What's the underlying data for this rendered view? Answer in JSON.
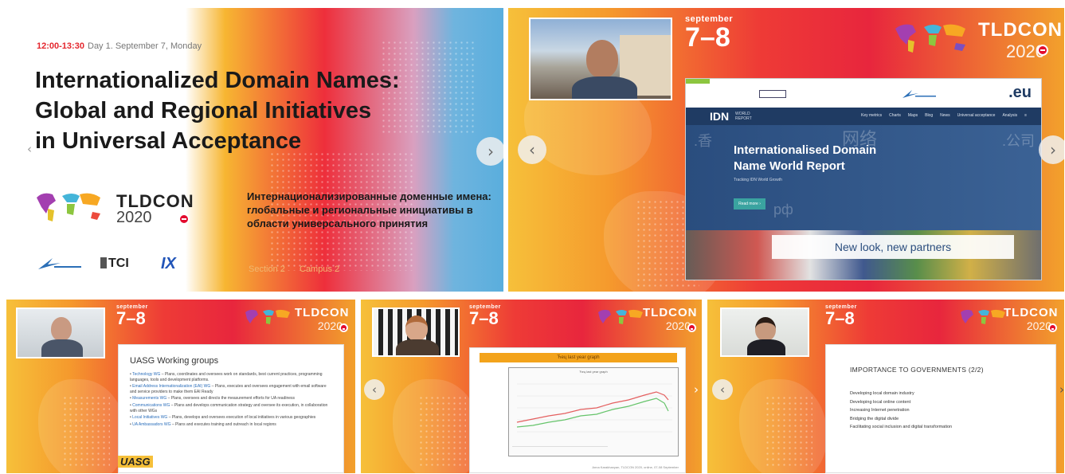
{
  "tile1": {
    "time": "12:00-13:30",
    "day": "Day 1. September 7, Monday",
    "title_lines": [
      "Internationalized Domain Names:",
      "Global and Regional Initiatives",
      "in Universal Acceptance"
    ],
    "brand_name": "TLDCON",
    "brand_year": "2020",
    "ru_title": "Интернационализированные доменные имена: глобальные и региональные инициативы в области универсального принятия",
    "section": "Section 2",
    "campus": "Campus 2",
    "logo_tci": "TCI",
    "logo_ix": "IX"
  },
  "common": {
    "sept_word": "september",
    "sept_days": "7–8",
    "brand_name": "TLDCON",
    "brand_year": "2020",
    "prev_icon": "‹",
    "next_icon": "›"
  },
  "tile2": {
    "eu_logo": ".eu",
    "idn_logo": "IDN",
    "idn_sub": "WORLD REPORT",
    "nav_links": [
      "Key metrics",
      "Charts",
      "Maps",
      "Blog",
      "News",
      "Universal acceptance",
      "Analysis"
    ],
    "hero_title": "Internationalised Domain Name World Report",
    "hero_sub": "Tracking IDN World Growth",
    "read_more": "Read more ›",
    "caption": "New look, new partners",
    "scripts": [
      ".香",
      "网络",
      ".公司",
      "рф"
    ]
  },
  "tile3": {
    "title": "UASG Working groups",
    "items": [
      {
        "name": "Technology WG",
        "text": " – Plans, coordinates and oversees work on standards, best current practices, programming languages, tools and development platforms."
      },
      {
        "name": "Email Address Internationalization (EAI) WG",
        "text": " – Plans, executes and oversees engagement with email software and service providers to make them EAI Ready"
      },
      {
        "name": "Measurements WG",
        "text": " – Plans, oversees and directs the measurement efforts for UA readiness"
      },
      {
        "name": "Communications WG",
        "text": " – Plans and develops communication strategy and oversee its execution, in collaboration with other WGs"
      },
      {
        "name": "Local Initiatives WG",
        "text": " – Plans, develops and oversees execution of local initiatives in various geographies"
      },
      {
        "name": "UA Ambassadors WG",
        "text": " – Plans and executes training and outreach in local regions"
      }
    ],
    "logo": "UASG"
  },
  "tile4": {
    "header": "Ћeц last year graph",
    "graph_title": "Ћeц last year graph",
    "footer": "Anna Karakhanyan, TLDCON 2020, online, 07-08 September"
  },
  "tile5": {
    "title": "IMPORTANCE TO GOVERNMENTS (2/2)",
    "items": [
      "Developing local domain industry",
      "Developing local online content",
      "Increasing Internet penetration",
      "Bridging the digital divide",
      "Facilitating social inclusion and digital transformation"
    ]
  },
  "colors": {
    "accent_red": "#e8263d",
    "accent_orange": "#f59a2d",
    "idn_navy": "#1f3b63",
    "link_blue": "#2a6ebb",
    "graph_green": "#66c46b",
    "graph_red": "#e46060"
  }
}
